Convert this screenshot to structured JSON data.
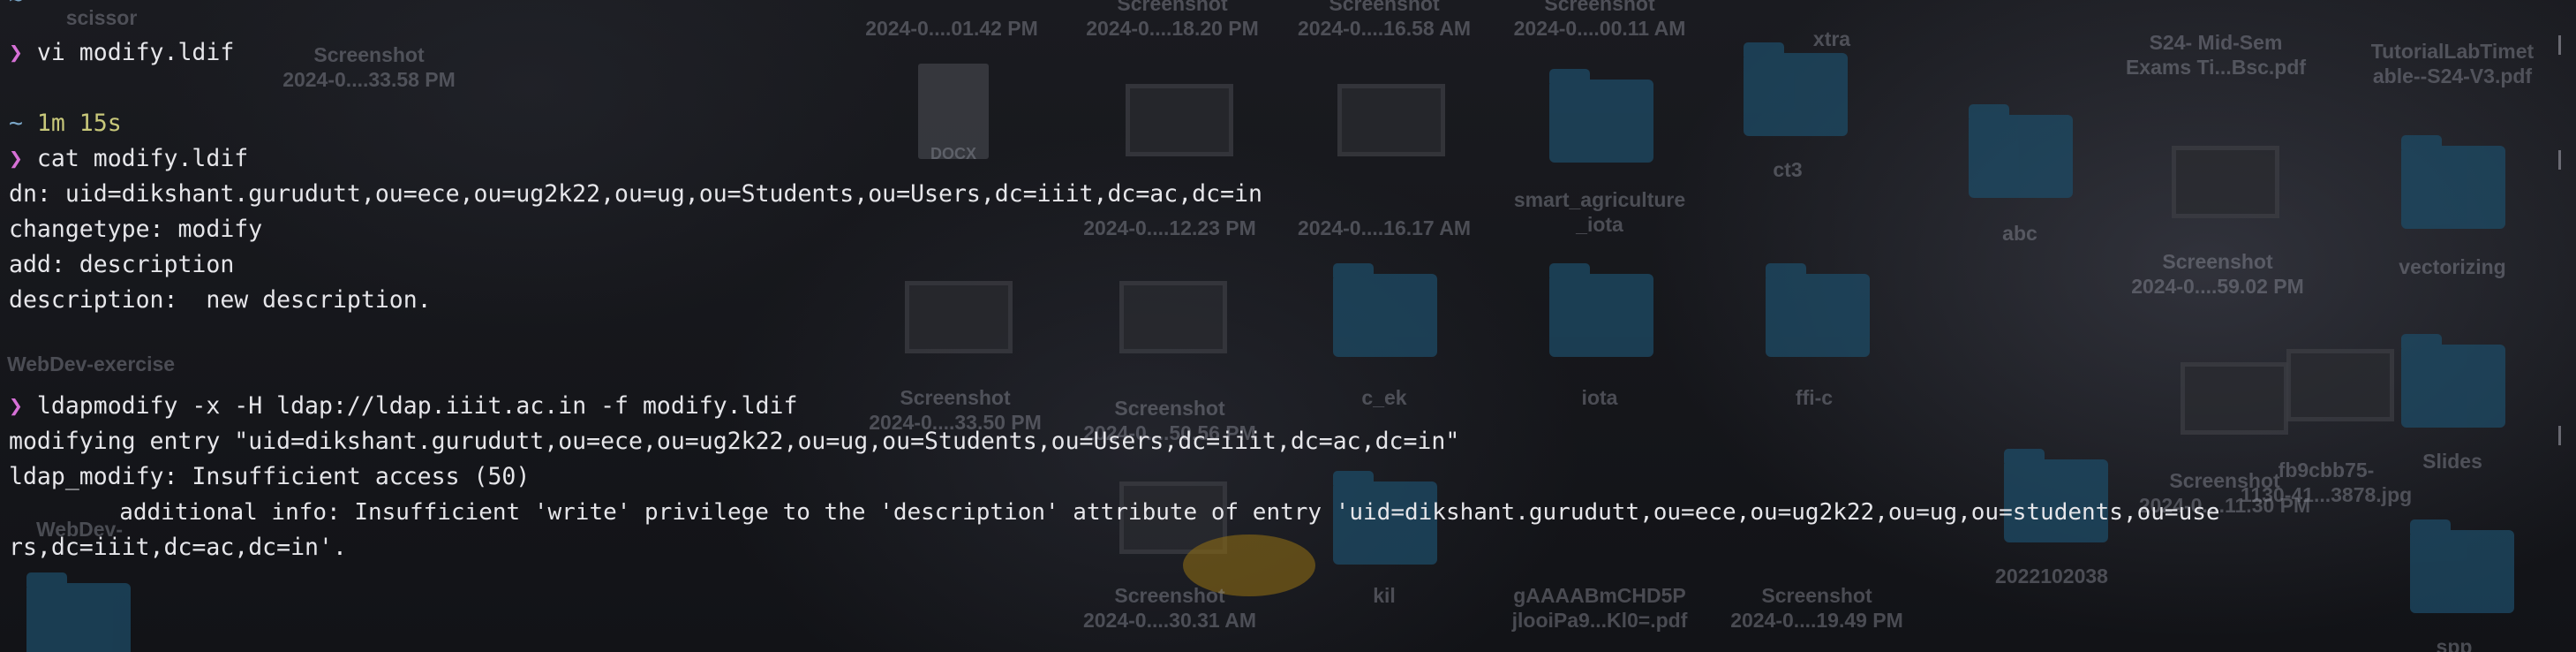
{
  "desktop": {
    "items": [
      {
        "name": "desk-label-scissor",
        "text": "scissor"
      },
      {
        "name": "desk-label-screenshot-1",
        "line1": "Screenshot",
        "line2": "2024-0....33.58 PM"
      },
      {
        "name": "desk-label-date-1",
        "text": "2024-0....01.42 PM"
      },
      {
        "name": "desk-label-date-2",
        "line1": "Screenshot",
        "line2": "2024-0....18.20 PM"
      },
      {
        "name": "desk-label-date-3",
        "line1": "Screenshot",
        "line2": "2024-0....16.58 AM"
      },
      {
        "name": "desk-label-date-4",
        "line1": "Screenshot",
        "line2": "2024-0....00.11 AM"
      },
      {
        "name": "desk-label-xtra",
        "text": "xtra"
      },
      {
        "name": "desk-label-exams",
        "line1": "S24- Mid-Sem",
        "line2": "Exams Ti...Bsc.pdf"
      },
      {
        "name": "desk-label-tutorial",
        "line1": "TutorialLabTimet",
        "line2": "able--S24-V3.pdf"
      },
      {
        "name": "desk-label-docx",
        "text": "DOCX"
      },
      {
        "name": "desk-label-ct3",
        "text": "ct3"
      },
      {
        "name": "desk-label-date-5",
        "text": "2024-0....12.23 PM"
      },
      {
        "name": "desk-label-date-6",
        "text": "2024-0....16.17 AM"
      },
      {
        "name": "desk-label-smart",
        "line1": "smart_agriculture",
        "line2": "_iota"
      },
      {
        "name": "desk-label-abc",
        "text": "abc"
      },
      {
        "name": "desk-label-screenshot-7",
        "line1": "Screenshot",
        "line2": "2024-0....59.02 PM"
      },
      {
        "name": "desk-label-vectorizing",
        "text": "vectorizing"
      },
      {
        "name": "desk-label-webdev",
        "text": "WebDev-exercise"
      },
      {
        "name": "desk-label-screenshot-8",
        "line1": "Screenshot",
        "line2": "2024-0....33.50 PM"
      },
      {
        "name": "desk-label-screenshot-9",
        "line1": "Screenshot",
        "line2": "2024-0....50.56 PM"
      },
      {
        "name": "desk-label-c-ek",
        "text": "c_ek"
      },
      {
        "name": "desk-label-iota",
        "text": "iota"
      },
      {
        "name": "desk-label-ffi-c",
        "text": "ffi-c"
      },
      {
        "name": "desk-label-slides",
        "text": "Slides"
      },
      {
        "name": "desk-label-screenshot-10",
        "line1": "Screenshot",
        "line2": "2024-0....11.30 PM"
      },
      {
        "name": "desk-label-jpg",
        "line1": "fb9cbb75-",
        "line2": "1130-41...3878.jpg"
      },
      {
        "name": "desk-label-webdev-2",
        "text": "WebDev-"
      },
      {
        "name": "desk-label-screenshot-11",
        "line1": "Screenshot",
        "line2": "2024-0....30.31 AM"
      },
      {
        "name": "desk-label-kil",
        "text": "kil"
      },
      {
        "name": "desk-label-gaaaa",
        "line1": "gAAAABmCHD5P",
        "line2": "jlooiPa9...Kl0=.pdf"
      },
      {
        "name": "desk-label-screenshot-12",
        "line1": "Screenshot",
        "line2": "2024-0....19.49 PM"
      },
      {
        "name": "desk-label-2022",
        "text": "2022102038"
      },
      {
        "name": "desk-label-spp",
        "text": "spp"
      }
    ]
  },
  "terminal": {
    "prompt_symbol": "❯",
    "tilde": "~",
    "lines": {
      "l1_cmd": " vi modify.ldif",
      "l2_timer": " 1m 15s",
      "l3_cmd": " cat modify.ldif",
      "l4": "dn: uid=dikshant.gurudutt,ou=ece,ou=ug2k22,ou=ug,ou=Students,ou=Users,dc=iiit,dc=ac,dc=in",
      "l5": "changetype: modify",
      "l6": "add: description",
      "l7": "description:  new description.",
      "l8_cmd": " ldapmodify -x -H ldap://ldap.iiit.ac.in -f modify.ldif",
      "l9": "modifying entry \"uid=dikshant.gurudutt,ou=ece,ou=ug2k22,ou=ug,ou=Students,ou=Users,dc=iiit,dc=ac,dc=in\"",
      "l10": "ldap_modify: Insufficient access (50)",
      "l11": "        additional info: Insufficient 'write' privilege to the 'description' attribute of entry 'uid=dikshant.gurudutt,ou=ece,ou=ug2k22,ou=ug,ou=students,ou=use",
      "l12": "rs,dc=iiit,dc=ac,dc=in'."
    }
  },
  "colors": {
    "background": "#15161a",
    "prompt": "#d670d6",
    "timer": "#c8c87a",
    "text": "#e6e6ea",
    "folder": "#1d4b66"
  }
}
